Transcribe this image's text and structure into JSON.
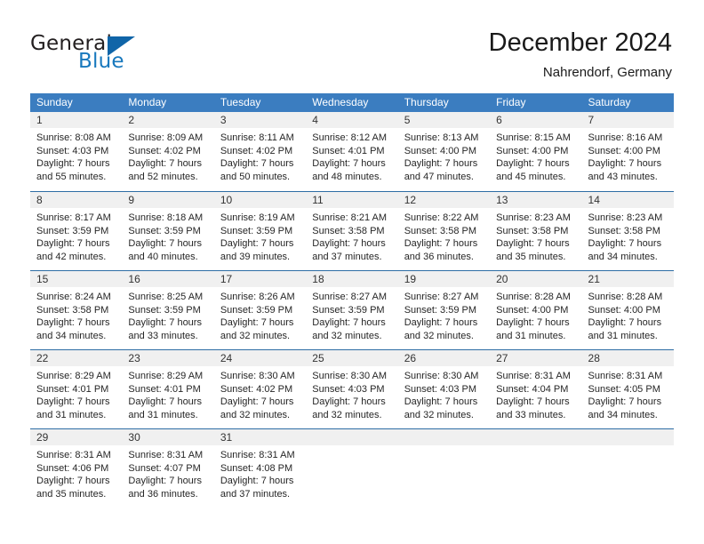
{
  "brand": {
    "name_top": "General",
    "name_bottom": "Blue",
    "accent_color": "#1065a8",
    "text_color": "#231f20"
  },
  "header": {
    "title": "December 2024",
    "subtitle": "Nahrendorf, Germany"
  },
  "theme": {
    "header_blue": "#3b7dc0",
    "rule_blue": "#2e6da4",
    "daynum_band": "#f0f0f0"
  },
  "weekdays": [
    "Sunday",
    "Monday",
    "Tuesday",
    "Wednesday",
    "Thursday",
    "Friday",
    "Saturday"
  ],
  "weeks": [
    [
      {
        "day": "1",
        "sunrise": "Sunrise: 8:08 AM",
        "sunset": "Sunset: 4:03 PM",
        "daylight1": "Daylight: 7 hours",
        "daylight2": "and 55 minutes."
      },
      {
        "day": "2",
        "sunrise": "Sunrise: 8:09 AM",
        "sunset": "Sunset: 4:02 PM",
        "daylight1": "Daylight: 7 hours",
        "daylight2": "and 52 minutes."
      },
      {
        "day": "3",
        "sunrise": "Sunrise: 8:11 AM",
        "sunset": "Sunset: 4:02 PM",
        "daylight1": "Daylight: 7 hours",
        "daylight2": "and 50 minutes."
      },
      {
        "day": "4",
        "sunrise": "Sunrise: 8:12 AM",
        "sunset": "Sunset: 4:01 PM",
        "daylight1": "Daylight: 7 hours",
        "daylight2": "and 48 minutes."
      },
      {
        "day": "5",
        "sunrise": "Sunrise: 8:13 AM",
        "sunset": "Sunset: 4:00 PM",
        "daylight1": "Daylight: 7 hours",
        "daylight2": "and 47 minutes."
      },
      {
        "day": "6",
        "sunrise": "Sunrise: 8:15 AM",
        "sunset": "Sunset: 4:00 PM",
        "daylight1": "Daylight: 7 hours",
        "daylight2": "and 45 minutes."
      },
      {
        "day": "7",
        "sunrise": "Sunrise: 8:16 AM",
        "sunset": "Sunset: 4:00 PM",
        "daylight1": "Daylight: 7 hours",
        "daylight2": "and 43 minutes."
      }
    ],
    [
      {
        "day": "8",
        "sunrise": "Sunrise: 8:17 AM",
        "sunset": "Sunset: 3:59 PM",
        "daylight1": "Daylight: 7 hours",
        "daylight2": "and 42 minutes."
      },
      {
        "day": "9",
        "sunrise": "Sunrise: 8:18 AM",
        "sunset": "Sunset: 3:59 PM",
        "daylight1": "Daylight: 7 hours",
        "daylight2": "and 40 minutes."
      },
      {
        "day": "10",
        "sunrise": "Sunrise: 8:19 AM",
        "sunset": "Sunset: 3:59 PM",
        "daylight1": "Daylight: 7 hours",
        "daylight2": "and 39 minutes."
      },
      {
        "day": "11",
        "sunrise": "Sunrise: 8:21 AM",
        "sunset": "Sunset: 3:58 PM",
        "daylight1": "Daylight: 7 hours",
        "daylight2": "and 37 minutes."
      },
      {
        "day": "12",
        "sunrise": "Sunrise: 8:22 AM",
        "sunset": "Sunset: 3:58 PM",
        "daylight1": "Daylight: 7 hours",
        "daylight2": "and 36 minutes."
      },
      {
        "day": "13",
        "sunrise": "Sunrise: 8:23 AM",
        "sunset": "Sunset: 3:58 PM",
        "daylight1": "Daylight: 7 hours",
        "daylight2": "and 35 minutes."
      },
      {
        "day": "14",
        "sunrise": "Sunrise: 8:23 AM",
        "sunset": "Sunset: 3:58 PM",
        "daylight1": "Daylight: 7 hours",
        "daylight2": "and 34 minutes."
      }
    ],
    [
      {
        "day": "15",
        "sunrise": "Sunrise: 8:24 AM",
        "sunset": "Sunset: 3:58 PM",
        "daylight1": "Daylight: 7 hours",
        "daylight2": "and 34 minutes."
      },
      {
        "day": "16",
        "sunrise": "Sunrise: 8:25 AM",
        "sunset": "Sunset: 3:59 PM",
        "daylight1": "Daylight: 7 hours",
        "daylight2": "and 33 minutes."
      },
      {
        "day": "17",
        "sunrise": "Sunrise: 8:26 AM",
        "sunset": "Sunset: 3:59 PM",
        "daylight1": "Daylight: 7 hours",
        "daylight2": "and 32 minutes."
      },
      {
        "day": "18",
        "sunrise": "Sunrise: 8:27 AM",
        "sunset": "Sunset: 3:59 PM",
        "daylight1": "Daylight: 7 hours",
        "daylight2": "and 32 minutes."
      },
      {
        "day": "19",
        "sunrise": "Sunrise: 8:27 AM",
        "sunset": "Sunset: 3:59 PM",
        "daylight1": "Daylight: 7 hours",
        "daylight2": "and 32 minutes."
      },
      {
        "day": "20",
        "sunrise": "Sunrise: 8:28 AM",
        "sunset": "Sunset: 4:00 PM",
        "daylight1": "Daylight: 7 hours",
        "daylight2": "and 31 minutes."
      },
      {
        "day": "21",
        "sunrise": "Sunrise: 8:28 AM",
        "sunset": "Sunset: 4:00 PM",
        "daylight1": "Daylight: 7 hours",
        "daylight2": "and 31 minutes."
      }
    ],
    [
      {
        "day": "22",
        "sunrise": "Sunrise: 8:29 AM",
        "sunset": "Sunset: 4:01 PM",
        "daylight1": "Daylight: 7 hours",
        "daylight2": "and 31 minutes."
      },
      {
        "day": "23",
        "sunrise": "Sunrise: 8:29 AM",
        "sunset": "Sunset: 4:01 PM",
        "daylight1": "Daylight: 7 hours",
        "daylight2": "and 31 minutes."
      },
      {
        "day": "24",
        "sunrise": "Sunrise: 8:30 AM",
        "sunset": "Sunset: 4:02 PM",
        "daylight1": "Daylight: 7 hours",
        "daylight2": "and 32 minutes."
      },
      {
        "day": "25",
        "sunrise": "Sunrise: 8:30 AM",
        "sunset": "Sunset: 4:03 PM",
        "daylight1": "Daylight: 7 hours",
        "daylight2": "and 32 minutes."
      },
      {
        "day": "26",
        "sunrise": "Sunrise: 8:30 AM",
        "sunset": "Sunset: 4:03 PM",
        "daylight1": "Daylight: 7 hours",
        "daylight2": "and 32 minutes."
      },
      {
        "day": "27",
        "sunrise": "Sunrise: 8:31 AM",
        "sunset": "Sunset: 4:04 PM",
        "daylight1": "Daylight: 7 hours",
        "daylight2": "and 33 minutes."
      },
      {
        "day": "28",
        "sunrise": "Sunrise: 8:31 AM",
        "sunset": "Sunset: 4:05 PM",
        "daylight1": "Daylight: 7 hours",
        "daylight2": "and 34 minutes."
      }
    ],
    [
      {
        "day": "29",
        "sunrise": "Sunrise: 8:31 AM",
        "sunset": "Sunset: 4:06 PM",
        "daylight1": "Daylight: 7 hours",
        "daylight2": "and 35 minutes."
      },
      {
        "day": "30",
        "sunrise": "Sunrise: 8:31 AM",
        "sunset": "Sunset: 4:07 PM",
        "daylight1": "Daylight: 7 hours",
        "daylight2": "and 36 minutes."
      },
      {
        "day": "31",
        "sunrise": "Sunrise: 8:31 AM",
        "sunset": "Sunset: 4:08 PM",
        "daylight1": "Daylight: 7 hours",
        "daylight2": "and 37 minutes."
      },
      {
        "day": "",
        "sunrise": "",
        "sunset": "",
        "daylight1": "",
        "daylight2": ""
      },
      {
        "day": "",
        "sunrise": "",
        "sunset": "",
        "daylight1": "",
        "daylight2": ""
      },
      {
        "day": "",
        "sunrise": "",
        "sunset": "",
        "daylight1": "",
        "daylight2": ""
      },
      {
        "day": "",
        "sunrise": "",
        "sunset": "",
        "daylight1": "",
        "daylight2": ""
      }
    ]
  ]
}
